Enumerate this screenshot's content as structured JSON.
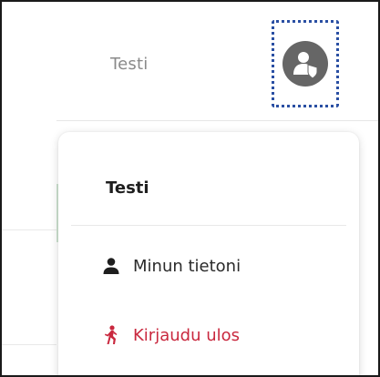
{
  "header": {
    "username": "Testi",
    "avatar_icon": "user-avatar-icon"
  },
  "dropdown": {
    "title": "Testi",
    "items": [
      {
        "label": "Minun tietoni",
        "icon": "person-icon"
      },
      {
        "label": "Kirjaudu ulos",
        "icon": "walking-person-icon",
        "color": "#c9283e"
      }
    ]
  },
  "colors": {
    "focus_ring": "#2a4fa3",
    "logout": "#c9283e",
    "avatar_bg": "#666666"
  }
}
